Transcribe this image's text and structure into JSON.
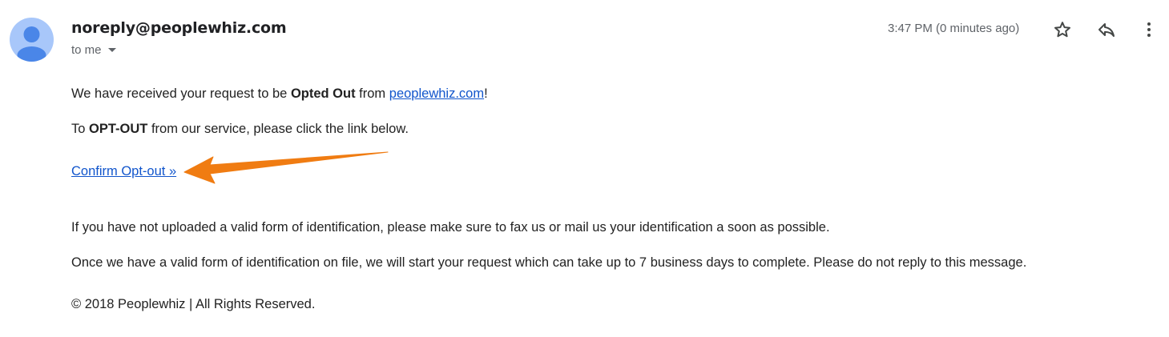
{
  "header": {
    "sender": "noreply@peoplewhiz.com",
    "recipient": "to me",
    "time": "3:47 PM (0 minutes ago)",
    "icons": [
      "avatar-icon",
      "star-icon",
      "reply-icon",
      "more-vert-icon"
    ]
  },
  "body": {
    "line1": {
      "prefix": "We have received your request to be ",
      "bold": "Opted Out",
      "middle": " from ",
      "link": "peoplewhiz.com",
      "suffix": "!"
    },
    "line2": {
      "prefix": "To ",
      "bold": "OPT-OUT",
      "suffix": " from our service, please click the link below."
    },
    "confirm_link": "Confirm Opt-out »",
    "line3": "If you have not uploaded a valid form of identification, please make sure to fax us or mail us your identification a soon as possible.",
    "line4": "Once we have a valid form of identification on file, we will start your request which can take up to 7 business days to complete. Please do not reply to this message.",
    "footer": "© 2018 Peoplewhiz | All Rights Reserved."
  },
  "colors": {
    "link": "#1155cc",
    "arrow": "#f07c12",
    "avatar_bg": "#a8c7fa",
    "avatar_fg": "#4a86e8"
  }
}
